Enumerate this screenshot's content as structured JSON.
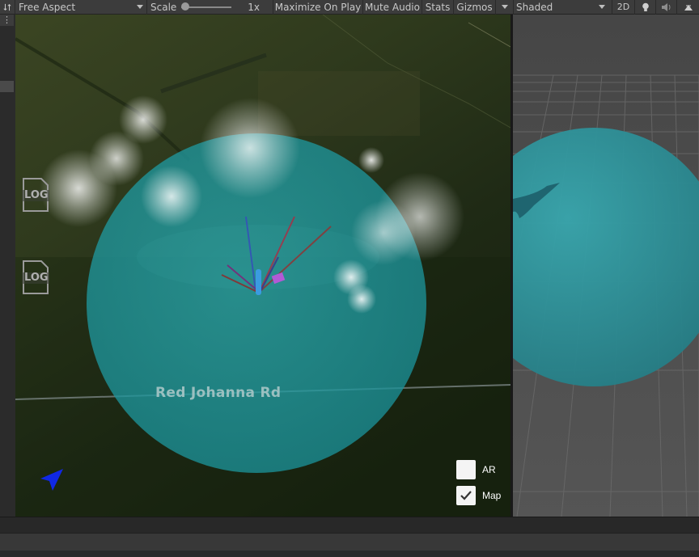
{
  "toolbar": {
    "aspect": "Free Aspect",
    "scale_label": "Scale",
    "scale_value": "1x",
    "maximize_on_play": "Maximize On Play",
    "mute_audio": "Mute Audio",
    "stats": "Stats",
    "gizmos": "Gizmos"
  },
  "scene_toolbar": {
    "shading_mode": "Shaded",
    "mode_2d": "2D"
  },
  "gutter": {
    "menu": "⋮"
  },
  "game": {
    "road_label": "Red Johanna Rd",
    "log_icon_text": "LOG",
    "toggles": [
      {
        "label": "AR",
        "checked": false
      },
      {
        "label": "Map",
        "checked": true
      }
    ],
    "colors": {
      "sphere": "#1c9aa0",
      "nav_arrow": "#1028e6"
    }
  }
}
